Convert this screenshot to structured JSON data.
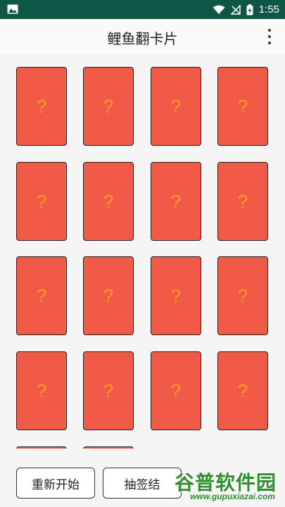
{
  "status_bar": {
    "time": "1:55",
    "icons": [
      "image-icon",
      "wifi-icon",
      "signal-off-icon",
      "battery-charging-icon"
    ]
  },
  "app_bar": {
    "title": "鲤鱼翻卡片",
    "menu_icon": "more-vert-icon"
  },
  "grid": {
    "card_symbol": "?",
    "cards": [
      "?",
      "?",
      "?",
      "?",
      "?",
      "?",
      "?",
      "?",
      "?",
      "?",
      "?",
      "?",
      "?",
      "?",
      "?",
      "?",
      "?",
      "?"
    ]
  },
  "bottom": {
    "restart_label": "重新开始",
    "result_label": "抽签结"
  },
  "watermark": {
    "text": "谷普软件园",
    "url": "www.gupuxiazai.com"
  },
  "colors": {
    "status_bar": "#0e5746",
    "card_face": "#f25a48",
    "card_symbol": "#f59b1f",
    "watermark": "#2f8f2f"
  }
}
